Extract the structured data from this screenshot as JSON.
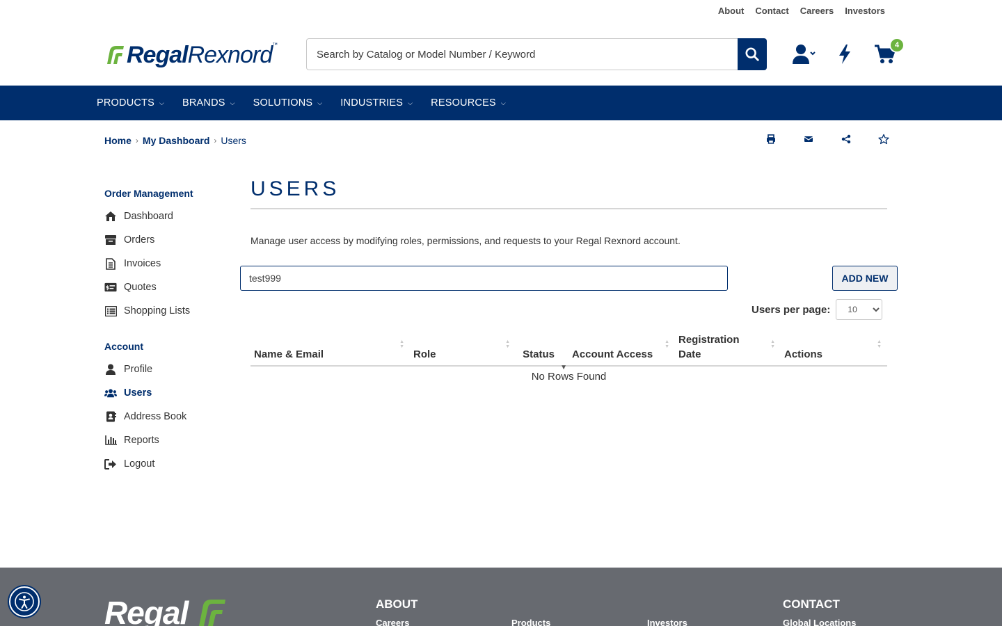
{
  "top_links": [
    "About",
    "Contact",
    "Careers",
    "Investors"
  ],
  "brand": {
    "bold": "Regal",
    "regular": "Rexnord",
    "tm": "™",
    "accent": "#6cb33f",
    "primary": "#002e6d"
  },
  "search": {
    "placeholder": "Search by Catalog or Model Number / Keyword",
    "value": ""
  },
  "header": {
    "cart_count": "4"
  },
  "nav": [
    "PRODUCTS",
    "BRANDS",
    "SOLUTIONS",
    "INDUSTRIES",
    "RESOURCES"
  ],
  "breadcrumb": {
    "home": "Home",
    "dashboard": "My Dashboard",
    "current": "Users"
  },
  "sidebar": {
    "order_heading": "Order Management",
    "order_items": [
      "Dashboard",
      "Orders",
      "Invoices",
      "Quotes",
      "Shopping Lists"
    ],
    "account_heading": "Account",
    "account_items": [
      "Profile",
      "Users",
      "Address Book",
      "Reports",
      "Logout"
    ],
    "active": "Users"
  },
  "main": {
    "title": "USERS",
    "description": "Manage user access by modifying roles, permissions, and requests to your Regal Rexnord account.",
    "filter_value": "test999",
    "add_new": "ADD NEW",
    "per_page_label": "Users per page:",
    "per_page_value": "10"
  },
  "table": {
    "columns": [
      "Name & Email",
      "Role",
      "Status",
      "Account Access",
      "Registration Date",
      "Actions"
    ],
    "empty": "No Rows Found"
  },
  "footer": {
    "logo": "Regal",
    "about_heading": "ABOUT",
    "contact_heading": "CONTACT",
    "links": [
      "Careers",
      "Products",
      "Investors",
      "Global Locations"
    ]
  }
}
